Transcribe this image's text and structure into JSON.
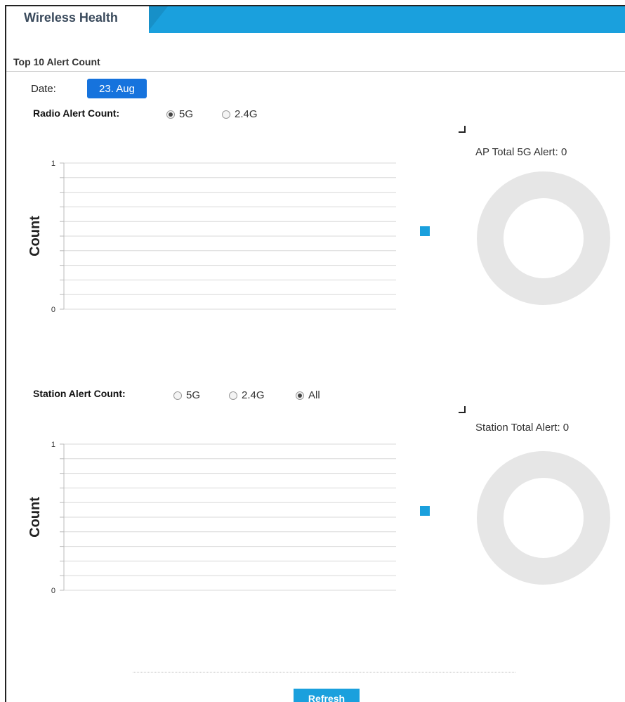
{
  "tabs": {
    "active_label": "Wireless Health"
  },
  "section": {
    "title": "Top 10 Alert Count"
  },
  "date": {
    "label": "Date:",
    "value": "23. Aug"
  },
  "radio_alert": {
    "label": "Radio Alert Count:",
    "options": [
      {
        "label": "5G",
        "checked": true
      },
      {
        "label": "2.4G",
        "checked": false
      }
    ],
    "ylabel": "Count",
    "donut_title": "AP Total 5G Alert: 0"
  },
  "station_alert": {
    "label": "Station Alert Count:",
    "options": [
      {
        "label": "5G",
        "checked": false
      },
      {
        "label": "2.4G",
        "checked": false
      },
      {
        "label": "All",
        "checked": true
      }
    ],
    "ylabel": "Count",
    "donut_title": "Station Total Alert: 0"
  },
  "chart_data": [
    {
      "type": "bar",
      "title": "",
      "xlabel": "",
      "ylabel": "Count",
      "categories": [],
      "values": [],
      "ylim": [
        0,
        1
      ],
      "yticks": [
        "0",
        "1"
      ],
      "grid": true
    },
    {
      "type": "pie",
      "title": "AP Total 5G Alert: 0",
      "values": []
    },
    {
      "type": "bar",
      "title": "",
      "xlabel": "",
      "ylabel": "Count",
      "categories": [],
      "values": [],
      "ylim": [
        0,
        1
      ],
      "yticks": [
        "0",
        "1"
      ],
      "grid": true
    },
    {
      "type": "pie",
      "title": "Station Total Alert: 0",
      "values": []
    }
  ],
  "colors": {
    "accent": "#1aa0dd",
    "date_badge": "#1673dd",
    "donut_empty": "#e6e6e6"
  },
  "actions": {
    "refresh_label": "Refresh"
  }
}
